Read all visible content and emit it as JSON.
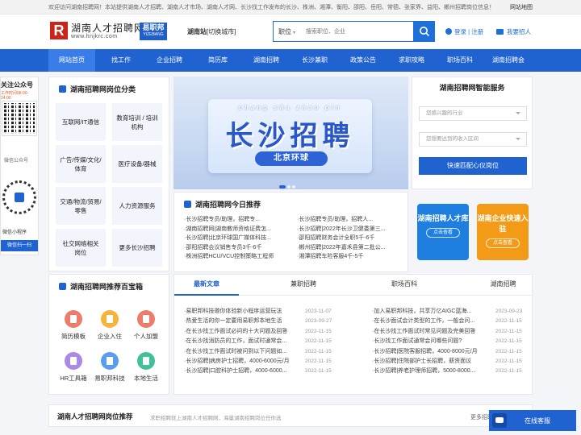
{
  "topbar": {
    "notice": "欢迎访问湖南招聘网！本站提供湖南人才招聘、湖南人才市场、湖南人才网、长沙找工作发布的长沙、株洲、湘潭、衡阳、邵阳、岳阳、常德、张家界、益阳、郴州招聘岗位信息！",
    "sitemap": "网站地图"
  },
  "header": {
    "logo_letter": "R",
    "logo_cn": "湖南人才招聘网",
    "logo_url": "www.hnjkrc.com",
    "logo_yz": "易职邦",
    "logo_yz_en": "YIZEBANG",
    "site_label": "湖南站",
    "site_switch": "[切换城市]",
    "search_category": "职位",
    "search_placeholder": "搜索职位、企业",
    "login": "登录",
    "separator": "|",
    "register": "注册",
    "hire": "我要招人"
  },
  "nav": [
    "网站首页",
    "找工作",
    "企业招聘",
    "简历库",
    "湖南招聘",
    "长沙兼职",
    "政策公告",
    "求职攻略",
    "职场百科",
    "湖南招聘会"
  ],
  "nav_active": 0,
  "wechat": {
    "title": "关注公众号",
    "hours": "工作时间08:00-24:00",
    "label": "微信公众号",
    "mini_label": "微信小程序",
    "mini_button": "微信扫一扫"
  },
  "categories": {
    "title": "湖南招聘网岗位分类",
    "items": [
      "互联网/IT通信",
      "教育培训 / 培训机构",
      "广告/传媒/文化/体育",
      "医疗设备/器械",
      "交通/物流/贸易/零售",
      "人力资源服务",
      "社交网络相关岗位",
      "更多长沙招聘"
    ]
  },
  "banner": {
    "pinyin": "chang sha zhao pin",
    "title": "长沙招聘",
    "subtitle": "北京环球"
  },
  "recommend": {
    "title": "湖南招聘网今日推荐",
    "left": [
      "·长沙招聘专员/助理，招聘专...",
      "·湖南招聘网|湖南教师资格证费怎...",
      "·长沙招聘|北京环球国广媒体科技...",
      "·邵阳招聘会议销售专员3千-6千",
      "·株洲招聘HCU/VCU控制策略工程师"
    ],
    "right": [
      "·长沙招聘专员/助理，招聘人...",
      "·长沙招聘|2022年长沙卫健委第三...",
      "·邵阳招聘财务会计全职5千-6千",
      "·郴州招聘|2022年嘉禾县第二批公...",
      "·湘潭招聘车险客服4千-5千"
    ]
  },
  "smart": {
    "title": "湖南招聘网智能服务",
    "select1": "您感兴趣的行业",
    "select2": "您想要达到的收入区间",
    "button": "快速匹配心仪岗位",
    "tile1_title": "湖南招聘人才库",
    "tile1_btn": "点击查看",
    "tile2_title": "湖南企业快速入驻",
    "tile2_btn": "点击查看",
    "tile1_color": "#1e7fe0",
    "tile2_color": "#f39b16"
  },
  "toolbox": {
    "title": "湖南招聘网推荐百宝箱",
    "items": [
      {
        "label": "简历模板",
        "color": "#f07b6b"
      },
      {
        "label": "企业入住",
        "color": "#f6b43a"
      },
      {
        "label": "个人加盟",
        "color": "#f07b6b"
      },
      {
        "label": "HR工具箱",
        "color": "#a98be6"
      },
      {
        "label": "易职邦科技",
        "color": "#5a9ef0"
      },
      {
        "label": "本地生活",
        "color": "#3fc29b"
      }
    ]
  },
  "news": {
    "tabs": [
      "最新文章",
      "兼职招聘",
      "职场百科",
      "湖南招聘"
    ],
    "active_tab": 0,
    "left": [
      {
        "t": "·易职邦科技邀你体验新小程序运营玩法",
        "d": "2023-11-07"
      },
      {
        "t": "·热爱生活的你一定要用易职邦本地生活",
        "d": "2023-09-27"
      },
      {
        "t": "·在长沙找工作面试必问的十大问题及回答",
        "d": "2022-11-15"
      },
      {
        "t": "·在长沙找消防员的工作，面试时通常会...",
        "d": "2022-11-15"
      },
      {
        "t": "·在长沙找工作面试时被问到以下问题如...",
        "d": "2022-11-15"
      },
      {
        "t": "·长沙招聘|病房护士招聘，4000-6000元/月",
        "d": "2022-11-15"
      },
      {
        "t": "·长沙招聘|口腔科护士招聘，4000-6000...",
        "d": "2022-11-15"
      }
    ],
    "right": [
      {
        "t": "·加入易职邦科技，共享万亿AIGC蓝海...",
        "d": "2023-09-23"
      },
      {
        "t": "·在长沙面试会计类型的工作，一般会问...",
        "d": "2022-11-15"
      },
      {
        "t": "·在长沙找工作面试时常见问题及完美回答",
        "d": "2022-11-15"
      },
      {
        "t": "·长沙找工作面试通常会问哪些问题?",
        "d": "2022-11-15"
      },
      {
        "t": "·长沙招聘|医院客服招聘，4000-8000元/月",
        "d": "2022-11-15"
      },
      {
        "t": "·长沙招聘|住院部护士长招聘，薪资面议",
        "d": "2022-11-15"
      },
      {
        "t": "·长沙招聘|养老护理师招聘，5000-8000...",
        "d": "2022-11-15"
      }
    ]
  },
  "footbar": {
    "title": "湖南人才招聘网岗位推荐",
    "sub": "求职招聘就上湖南人才招聘网，海量湖南招聘岗位任你选",
    "more": "更多招聘"
  },
  "chat": {
    "label": "在线客服"
  }
}
